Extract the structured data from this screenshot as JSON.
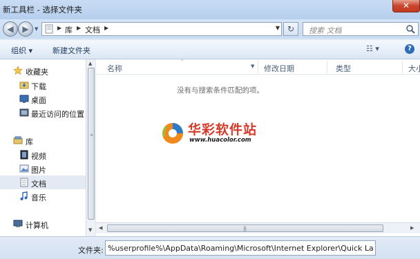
{
  "window": {
    "title": "新工具栏 - 选择文件夹",
    "close_glyph": "✕"
  },
  "address": {
    "segments": [
      "库",
      "文档"
    ]
  },
  "search": {
    "placeholder": "搜索 文档"
  },
  "toolbar": {
    "organize_label": "组织 ▾",
    "newfolder_label": "新建文件夹",
    "view_glyph": "☷ ▾",
    "help_glyph": "?"
  },
  "navpane": {
    "favorites": {
      "label": "收藏夹",
      "items": [
        {
          "label": "下载",
          "icon": "download-folder-icon"
        },
        {
          "label": "桌面",
          "icon": "desktop-icon"
        },
        {
          "label": "最近访问的位置",
          "icon": "recent-places-icon"
        }
      ]
    },
    "libraries": {
      "label": "库",
      "items": [
        {
          "label": "视频",
          "icon": "video-icon"
        },
        {
          "label": "图片",
          "icon": "pictures-icon"
        },
        {
          "label": "文档",
          "icon": "documents-icon",
          "selected": true
        },
        {
          "label": "音乐",
          "icon": "music-icon"
        }
      ]
    },
    "computer": {
      "label": "计算机",
      "icon": "computer-icon"
    }
  },
  "filelist": {
    "columns": [
      "名称",
      "修改日期",
      "类型",
      "大小"
    ],
    "empty_message": "没有与搜索条件匹配的项。"
  },
  "watermark": {
    "name": "华彩软件站",
    "url": "www.huacolor.com"
  },
  "filename": {
    "label": "文件夹:",
    "value": "%userprofile%\\AppData\\Roaming\\Microsoft\\Internet Explorer\\Quick Launch"
  },
  "colors": {
    "accent": "#2e6bb8",
    "watermark_red": "#d43a2a",
    "selection": "#e3eaf3"
  }
}
